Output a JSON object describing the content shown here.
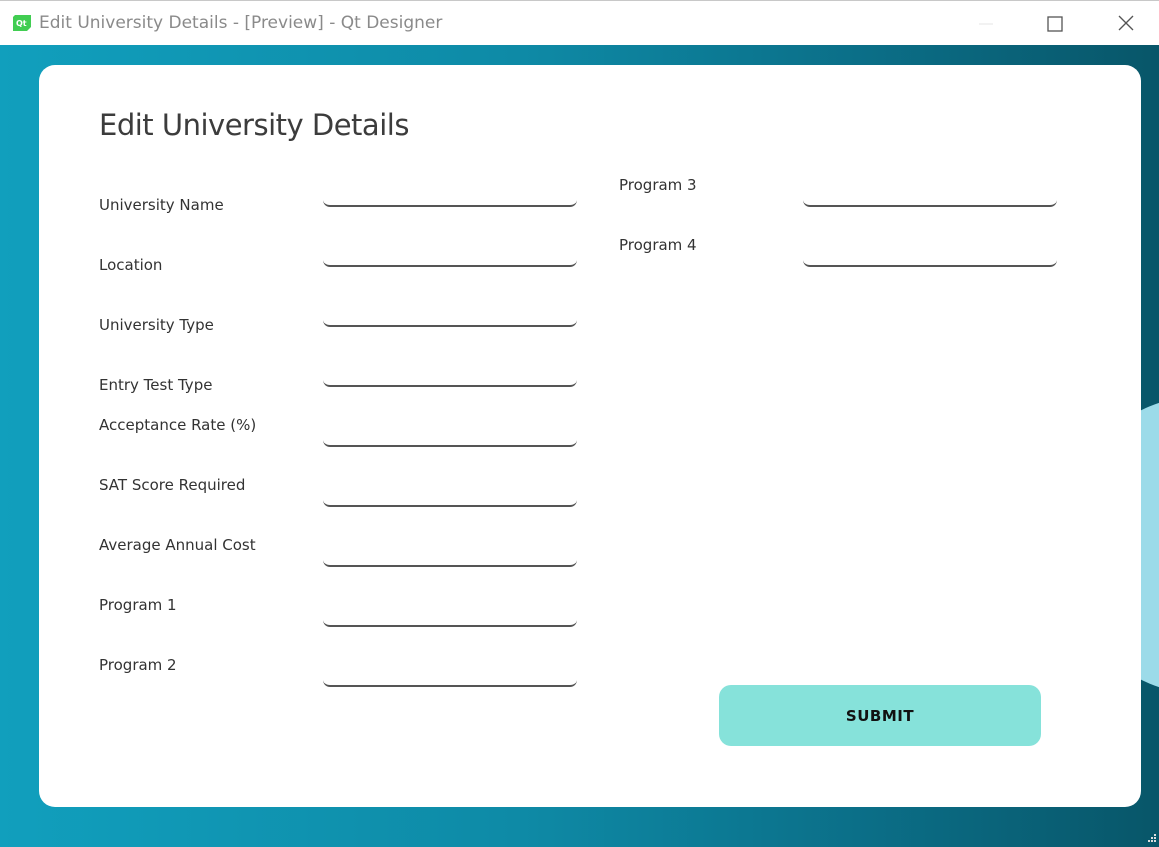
{
  "window": {
    "title": "Edit University Details - [Preview] - Qt Designer",
    "app_icon": "qt-icon",
    "controls": [
      "minimize-icon",
      "maximize-icon",
      "close-icon"
    ]
  },
  "form": {
    "heading": "Edit University Details",
    "left_fields": [
      {
        "label": "University Name",
        "value": ""
      },
      {
        "label": "Location",
        "value": ""
      },
      {
        "label": "University Type",
        "value": ""
      },
      {
        "label": "Entry Test Type",
        "value": ""
      },
      {
        "label": "Acceptance Rate (%)",
        "value": ""
      },
      {
        "label": "SAT Score Required",
        "value": ""
      },
      {
        "label": "Average Annual Cost",
        "value": ""
      },
      {
        "label": "Program 1",
        "value": ""
      },
      {
        "label": "Program 2",
        "value": ""
      }
    ],
    "right_fields": [
      {
        "label": "Program 3",
        "value": ""
      },
      {
        "label": "Program 4",
        "value": ""
      }
    ],
    "submit_label": "SUBMIT"
  },
  "colors": {
    "background_start": "#119fbd",
    "background_end": "#085669",
    "accent_blob": "#9cdbe9",
    "button": "#86e2da",
    "card": "#ffffff"
  }
}
